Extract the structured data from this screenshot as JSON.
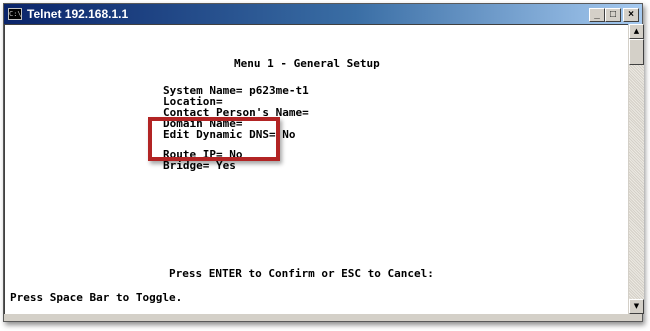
{
  "window": {
    "title": "Telnet 192.168.1.1",
    "app_icon_text": "C:\\",
    "controls": {
      "minimize": "_",
      "maximize": "□",
      "close": "×"
    }
  },
  "terminal": {
    "menu_title": "Menu 1 - General Setup",
    "system_name": "System Name= p623me-t1",
    "location": "Location=",
    "contact_person": "Contact Person's Name=",
    "domain_name": "Domain Name=",
    "edit_dynamic_dns": "Edit Dynamic DNS= No",
    "route_ip": "Route IP= No",
    "bridge": "Bridge= Yes",
    "confirm_prompt": "Press ENTER to Confirm or ESC to Cancel:",
    "toggle_hint": "Press Space Bar to Toggle."
  },
  "scrollbar": {
    "up_arrow": "▲",
    "down_arrow": "▼"
  },
  "colors": {
    "highlight_border": "#b22424",
    "titlebar_start": "#0a246a",
    "titlebar_end": "#a6caf0",
    "terminal_background": "#ffffff",
    "terminal_text": "#000000"
  }
}
